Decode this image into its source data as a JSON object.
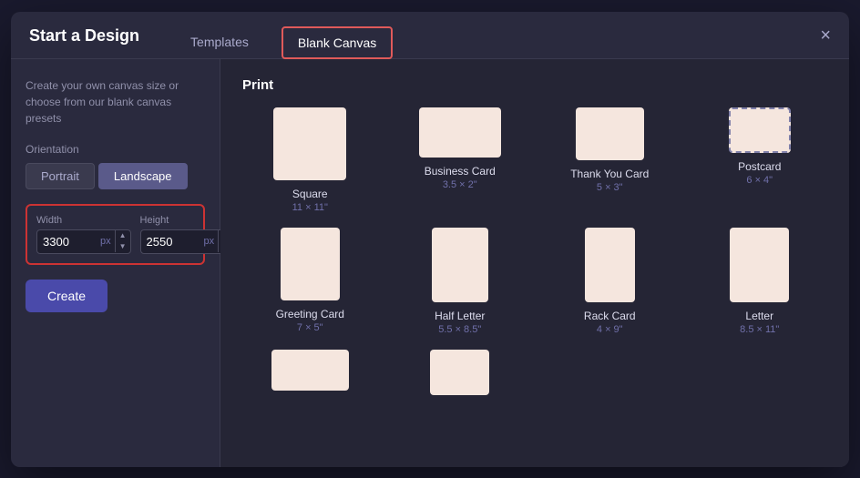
{
  "modal": {
    "title": "Start a Design",
    "close_label": "×"
  },
  "tabs": [
    {
      "id": "templates",
      "label": "Templates",
      "active": false
    },
    {
      "id": "blank-canvas",
      "label": "Blank Canvas",
      "active": true
    }
  ],
  "sidebar": {
    "description": "Create your own canvas size or choose from our blank canvas presets",
    "orientation_label": "Orientation",
    "orientations": [
      {
        "id": "portrait",
        "label": "Portrait",
        "active": false
      },
      {
        "id": "landscape",
        "label": "Landscape",
        "active": true
      }
    ],
    "width_label": "Width",
    "height_label": "Height",
    "width_value": "3300",
    "height_value": "2550",
    "unit": "px",
    "create_label": "Create"
  },
  "main": {
    "section_title": "Print",
    "cards": [
      {
        "id": "square",
        "name": "Square",
        "size": "11 × 11\"",
        "shape": "square"
      },
      {
        "id": "bizcard",
        "name": "Business Card",
        "size": "3.5 × 2\"",
        "shape": "bizcard"
      },
      {
        "id": "thankyou",
        "name": "Thank You Card",
        "size": "5 × 3\"",
        "shape": "thankyou"
      },
      {
        "id": "postcard",
        "name": "Postcard",
        "size": "6 × 4\"",
        "shape": "postcard"
      },
      {
        "id": "greeting",
        "name": "Greeting Card",
        "size": "7 × 5\"",
        "shape": "greeting"
      },
      {
        "id": "halfletter",
        "name": "Half Letter",
        "size": "5.5 × 8.5\"",
        "shape": "halfletter"
      },
      {
        "id": "rackcard",
        "name": "Rack Card",
        "size": "4 × 9\"",
        "shape": "rackcard"
      },
      {
        "id": "letter",
        "name": "Letter",
        "size": "8.5 × 11\"",
        "shape": "letter"
      },
      {
        "id": "small1",
        "name": "",
        "size": "",
        "shape": "small1"
      },
      {
        "id": "small2",
        "name": "",
        "size": "",
        "shape": "small2"
      }
    ]
  }
}
